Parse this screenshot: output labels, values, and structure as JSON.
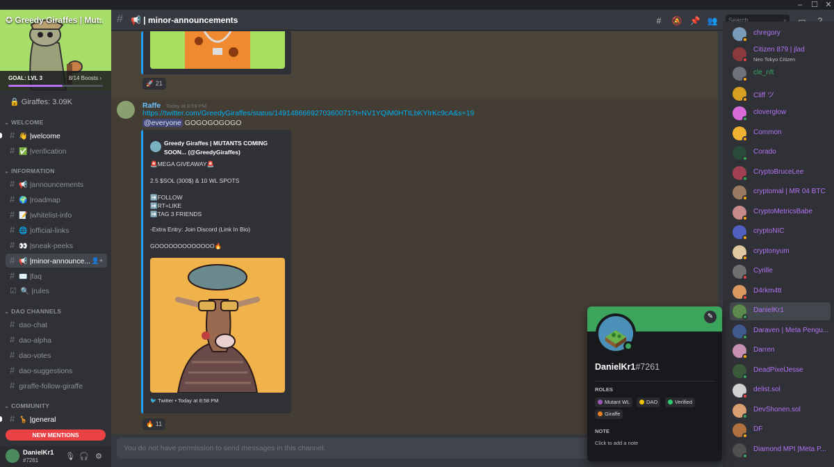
{
  "server": {
    "name": "Greedy Giraffes | Mut...",
    "goal": "GOAL: LVL 3",
    "boosts": "8/14 Boosts ›",
    "boost_progress": 0.57,
    "stat": "Giraffes: 3.09K",
    "banner_color": "#a8de6a"
  },
  "categories": {
    "welcome": "WELCOME",
    "information": "INFORMATION",
    "dao": "DAO CHANNELS",
    "community": "COMMUNITY"
  },
  "channels": {
    "welcome": {
      "emoji": "👋",
      "name": "welcome"
    },
    "verification": {
      "emoji": "✅",
      "name": "verification"
    },
    "announcements": {
      "emoji": "📢",
      "name": "announcements"
    },
    "roadmap": {
      "emoji": "🌍",
      "name": "roadmap"
    },
    "whitelist": {
      "emoji": "📝",
      "name": "whitelist-info"
    },
    "official": {
      "emoji": "🌐",
      "name": "official-links"
    },
    "sneak": {
      "emoji": "👀",
      "name": "sneak-peeks"
    },
    "minor": {
      "emoji": "📢",
      "name": "minor-announce..."
    },
    "faq": {
      "emoji": "✉️",
      "name": "faq"
    },
    "rules": {
      "emoji": "🔍",
      "name": "rules"
    },
    "dao_chat": "dao-chat",
    "dao_alpha": "dao-alpha",
    "dao_votes": "dao-votes",
    "dao_suggestions": "dao-suggestions",
    "giraffe_follow": "giraffe-follow-giraffe",
    "general": {
      "emoji": "🦒",
      "name": "general"
    }
  },
  "new_mentions": "NEW MENTIONS",
  "user": {
    "name": "DanielKr1",
    "tag": "#7261"
  },
  "header": {
    "title": "📢 | minor-announcements",
    "search_placeholder": "Search"
  },
  "messages": {
    "first_reaction": {
      "emoji": "🚀",
      "count": "21"
    },
    "post": {
      "author": "Raffe",
      "timestamp": "Today at 8:59 PM",
      "link": "https://twitter.com/GreedyGiraffes/status/1491486669270360071?t=NV1YQiM0HTtLbKYIrKc9cA&s=19",
      "mention": "@everyone",
      "text": " GOGOGOGOGO",
      "embed": {
        "author": "Greedy Giraffes | MUTANTS COMING SOON... (@GreedyGiraffes)",
        "line1": "🚨MEGA GIVEAWAY🚨",
        "line2": "2.5 $SOL (300$) & 10 WL SPOTS",
        "line3": "➡️FOLLOW",
        "line4": "➡️RT+LIKE",
        "line5": "➡️TAG 3 FRIENDS",
        "line6": "-Extra Entry: Join Discord (Link In Bio)",
        "line7": "GOOOOOOOOOOOOO🔥",
        "footer": "Twitter • Today at 8:58 PM"
      },
      "reaction": {
        "emoji": "🔥",
        "count": "11"
      }
    }
  },
  "input_placeholder": "You do not have permission to send messages in this channel.",
  "members": [
    {
      "name": "chregory",
      "color": "#b473f5",
      "av": "#7a9bb8",
      "status": "#faa81a"
    },
    {
      "name": "Citizen 879 | jlad",
      "sub": "Neo Tokyo Citizen",
      "color": "#b473f5",
      "av": "#8a3a3a",
      "status": "#ed4245"
    },
    {
      "name": "cle_nft",
      "color": "#3ba55c",
      "av": "#6d7278",
      "status": "#faa81a"
    },
    {
      "name": "Cliff ツ",
      "color": "#b473f5",
      "av": "#d6a020",
      "status": "#faa81a"
    },
    {
      "name": "cloverglow",
      "color": "#b473f5",
      "av": "#d86ad8",
      "status": "#3ba55c"
    },
    {
      "name": "Common",
      "color": "#b473f5",
      "av": "#f0b232",
      "status": "#faa81a"
    },
    {
      "name": "Corado",
      "color": "#b473f5",
      "av": "#2a4a3a",
      "status": "#3ba55c"
    },
    {
      "name": "CryptoBruceLee",
      "color": "#b473f5",
      "av": "#a04050",
      "status": "#3ba55c"
    },
    {
      "name": "cryptomal | MR 04 BTC",
      "color": "#b473f5",
      "av": "#9a7a60",
      "status": "#faa81a"
    },
    {
      "name": "CryptoMetricsBabe",
      "color": "#b473f5",
      "av": "#c88a8a",
      "status": "#faa81a"
    },
    {
      "name": "cryptoNIC",
      "color": "#b473f5",
      "av": "#5060c0",
      "status": "#faa81a"
    },
    {
      "name": "cryptonyum",
      "color": "#b473f5",
      "av": "#e0c8a0",
      "status": "#faa81a"
    },
    {
      "name": "Cyrille",
      "color": "#b473f5",
      "av": "#707070",
      "status": "#ed4245"
    },
    {
      "name": "D4rkm4tt",
      "color": "#b473f5",
      "av": "#d89860",
      "status": "#ed4245"
    },
    {
      "name": "DanielKr1",
      "color": "#b473f5",
      "av": "#5b8a4a",
      "status": "#3ba55c"
    },
    {
      "name": "Daraven | Meta Pengu...",
      "color": "#b473f5",
      "av": "#405a90",
      "status": "#3ba55c"
    },
    {
      "name": "Darren",
      "color": "#b473f5",
      "av": "#c890b0",
      "status": "#faa81a"
    },
    {
      "name": "DeadPixelJesse",
      "color": "#b473f5",
      "av": "#3a5a3a",
      "status": "#3ba55c"
    },
    {
      "name": "delist.sol",
      "color": "#b473f5",
      "av": "#d0d0d0",
      "status": "#ed4245"
    },
    {
      "name": "DevShonen.sol",
      "color": "#b473f5",
      "av": "#d8a070",
      "status": "#3ba55c"
    },
    {
      "name": "DF",
      "color": "#b473f5",
      "av": "#b07040",
      "status": "#faa81a"
    },
    {
      "name": "Diamond MPI |Meta P...",
      "color": "#b473f5",
      "av": "#505050",
      "status": "#3ba55c"
    }
  ],
  "profile": {
    "name": "DanielKr1",
    "tag": "#7261",
    "roles_title": "ROLES",
    "roles": [
      {
        "name": "Mutant WL",
        "color": "#9b59b6"
      },
      {
        "name": "DAO",
        "color": "#f1c40f"
      },
      {
        "name": "Verified",
        "color": "#2ecc71"
      },
      {
        "name": "Giraffe",
        "color": "#e67e22"
      }
    ],
    "note_title": "NOTE",
    "note_placeholder": "Click to add a note",
    "banner_color": "#3ba55c"
  }
}
